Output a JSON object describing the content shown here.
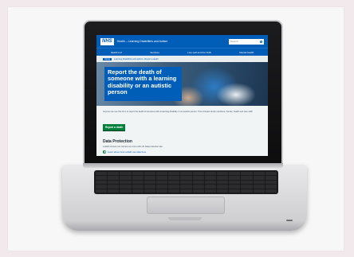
{
  "website": {
    "logo": "NHS",
    "site_name": "Health – Learning Disabilities and Autism",
    "search_placeholder": "Search",
    "nav": [
      "Health A-Z",
      "Services",
      "Live well and the NHS",
      "Mental health"
    ],
    "breadcrumb": {
      "home": "Home",
      "path": "Learning disabilities and autism › Report a death"
    },
    "hero_title": "Report the death of someone with a learning disability or an autistic person",
    "intro": "Anyone can use this form to report the death of someone with a learning disability or an autistic person. This includes family members, friends, health and care staff.",
    "button": "Report a death",
    "section_heading": "Data Protection",
    "section_text": "LeDeR reviews are carried out in line with UK data protection law.",
    "link": "Learn about how LeDeR use data here"
  }
}
